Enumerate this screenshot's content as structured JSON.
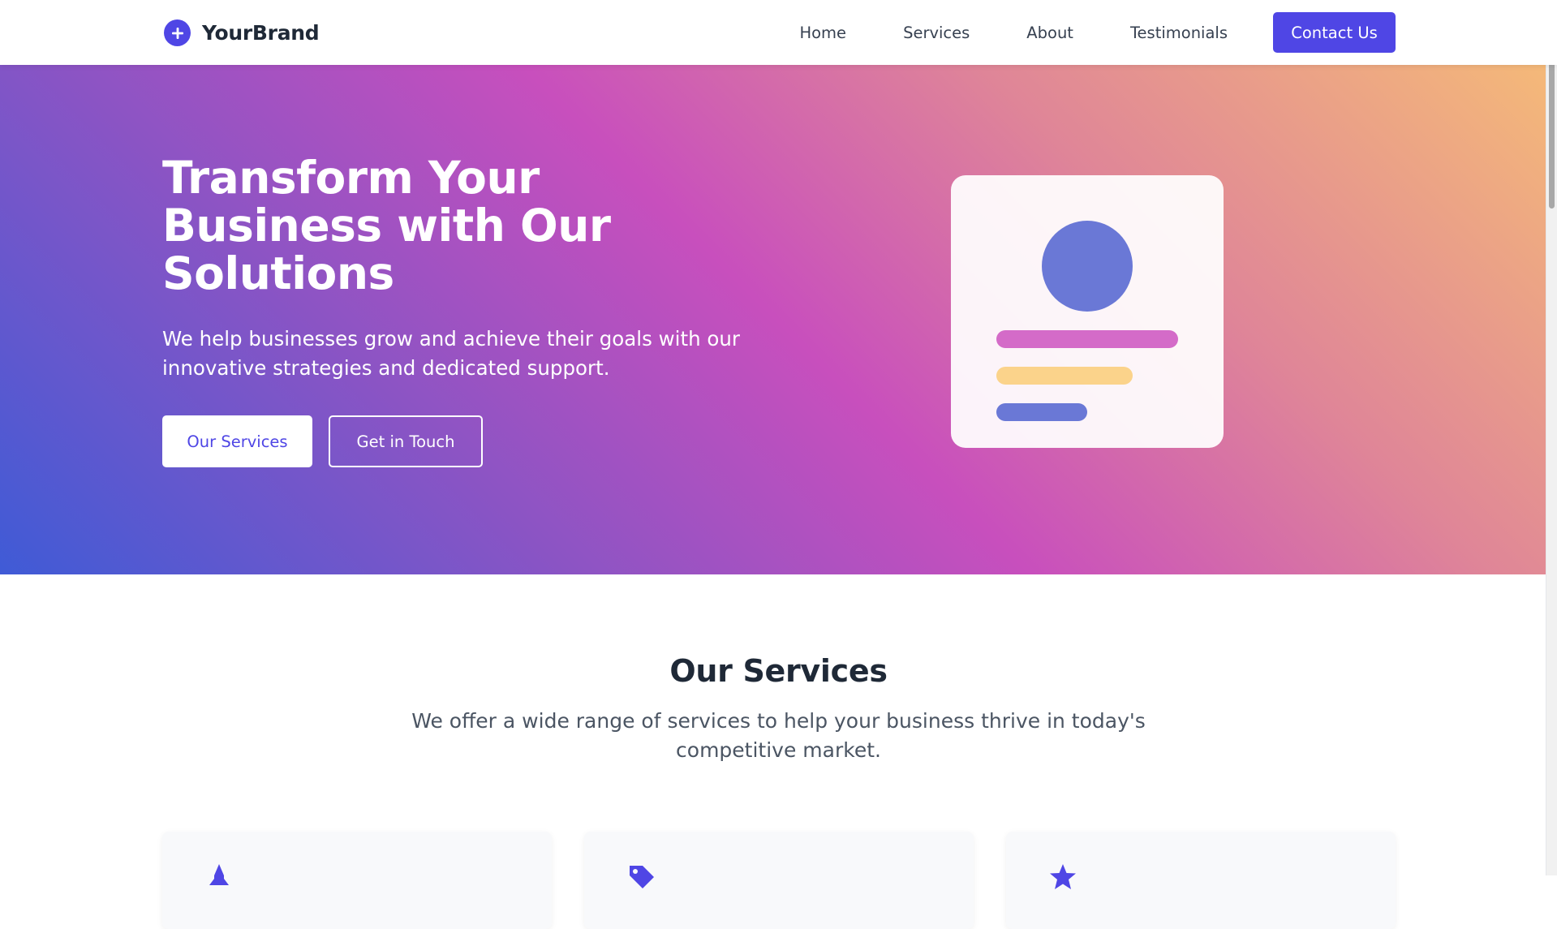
{
  "header": {
    "brand_name": "YourBrand",
    "nav": [
      {
        "label": "Home"
      },
      {
        "label": "Services"
      },
      {
        "label": "About"
      },
      {
        "label": "Testimonials"
      }
    ],
    "cta_label": "Contact Us"
  },
  "hero": {
    "title": "Transform Your Business with Our Solutions",
    "subtitle": "We help businesses grow and achieve their goals with our innovative strategies and dedicated support.",
    "primary_button": "Our Services",
    "secondary_button": "Get in Touch"
  },
  "services": {
    "title": "Our Services",
    "subtitle": "We offer a wide range of services to help your business thrive in today's competitive market."
  },
  "colors": {
    "accent": "#4f46e5",
    "hero_gradient": [
      "#3f5bd6",
      "#c84fbd",
      "#f5ba78"
    ],
    "card_avatar": "#6a78d6",
    "card_line_pink": "#d46bc8",
    "card_line_yellow": "#fbd38b"
  },
  "icons": {
    "brand": "plus-circle-icon",
    "service_1": "rocket-icon",
    "service_2": "tag-icon",
    "service_3": "star-icon"
  }
}
